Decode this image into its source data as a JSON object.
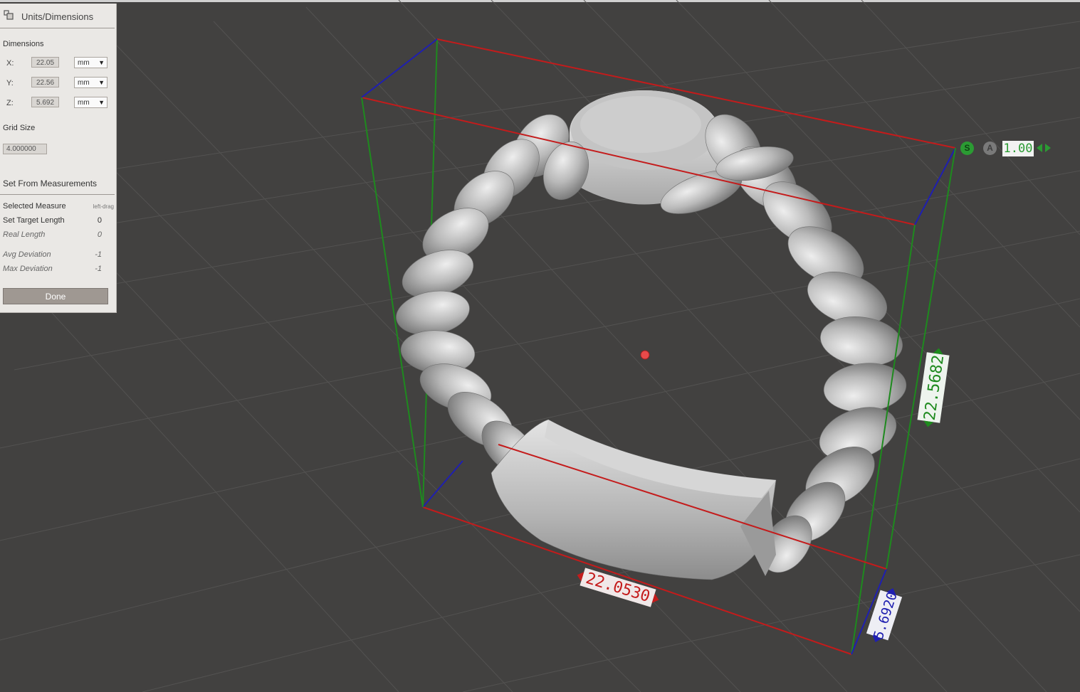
{
  "panel": {
    "title": "Units/Dimensions",
    "dimensions_label": "Dimensions",
    "dims": [
      {
        "axis": "X:",
        "value": "22.05",
        "unit": "mm"
      },
      {
        "axis": "Y:",
        "value": "22.56",
        "unit": "mm"
      },
      {
        "axis": "Z:",
        "value": "5.692",
        "unit": "mm"
      }
    ],
    "grid_size_label": "Grid Size",
    "grid_size_value": "4.000000",
    "set_from_label": "Set From Measurements",
    "selected_measure_label": "Selected Measure",
    "selected_measure_value": "left-drag",
    "set_target_length_label": "Set Target Length",
    "set_target_length_value": "0",
    "real_length_label": "Real Length",
    "real_length_value": "0",
    "avg_deviation_label": "Avg Deviation",
    "avg_deviation_value": "-1",
    "max_deviation_label": "Max Deviation",
    "max_deviation_value": "-1",
    "done_label": "Done",
    "dropdown_arrow": "▼"
  },
  "viewport": {
    "s_button": "S",
    "a_button": "A",
    "scale_value": "1.00",
    "dim_x_label": "22.0530",
    "dim_y_label": "22.5682",
    "dim_z_label": "5.6920"
  },
  "colors": {
    "x_axis": "#c41b1b",
    "y_axis": "#1e8a1e",
    "z_axis": "#1f1fb0",
    "panel_bg": "#eae8e5",
    "viewport_bg": "#424140",
    "done_bg": "#9f9892"
  }
}
